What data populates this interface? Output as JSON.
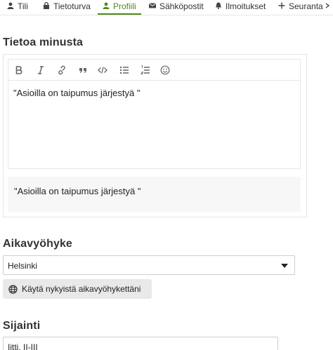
{
  "nav": {
    "tabs": [
      {
        "label": "Tili",
        "icon": "user-icon"
      },
      {
        "label": "Tietoturva",
        "icon": "lock-icon"
      },
      {
        "label": "Profiili",
        "icon": "user-icon",
        "active": true
      },
      {
        "label": "Sähköpostit",
        "icon": "envelope-icon"
      },
      {
        "label": "Ilmoitukset",
        "icon": "bell-icon"
      },
      {
        "label": "Seuranta",
        "icon": "plus-icon"
      },
      {
        "label": "",
        "icon": "more-icon"
      }
    ]
  },
  "about": {
    "title": "Tietoa minusta",
    "toolbar": [
      "bold-icon",
      "italic-icon",
      "link-icon",
      "quote-icon",
      "code-icon",
      "bullet-list-icon",
      "numbered-list-icon",
      "emoji-icon"
    ],
    "text": "\"Asioilla on taipumus järjestyä \"",
    "preview": "\"Asioilla on taipumus järjestyä \""
  },
  "timezone": {
    "title": "Aikavyöhyke",
    "selected": "Helsinki",
    "use_current_label": "Käytä nykyistä aikavyöhykettäni"
  },
  "location": {
    "title": "Sijainti",
    "value": "Iitti, II-III"
  },
  "colors": {
    "accent": "#4e8a1b",
    "border": "#e6e6e6",
    "button_bg": "#e9e9e9"
  }
}
